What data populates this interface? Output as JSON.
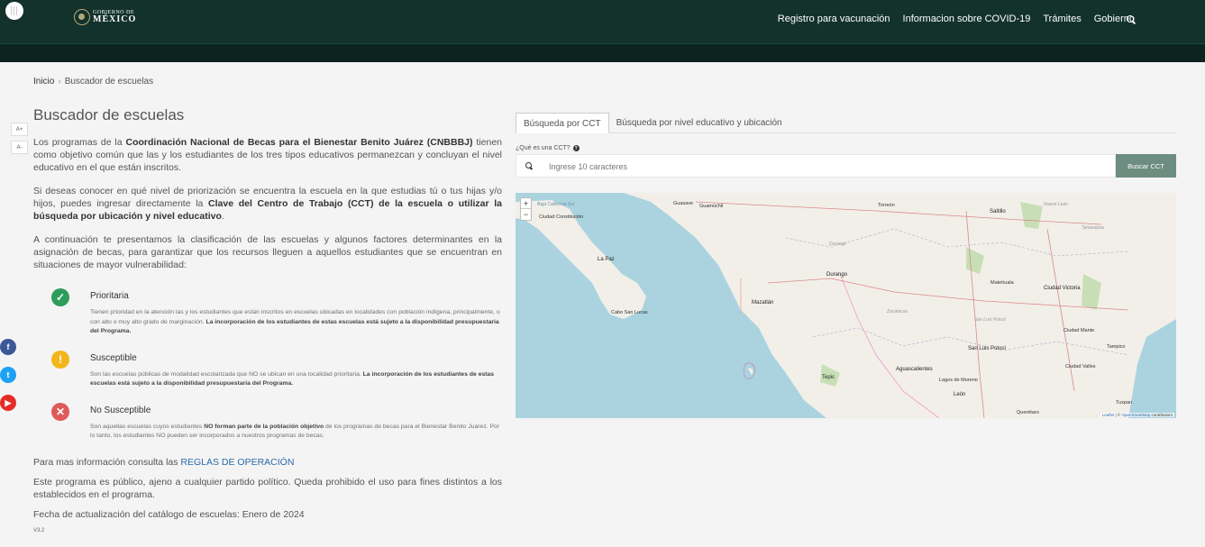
{
  "header": {
    "logo_line1": "GOBIERNO DE",
    "logo_line2": "MÉXICO",
    "nav": [
      "Registro para vacunación",
      "Informacion sobre COVID-19",
      "Trámites",
      "Gobierno"
    ]
  },
  "breadcrumb": {
    "home": "Inicio",
    "current": "Buscador de escuelas"
  },
  "font_tools": [
    "A+",
    "A-"
  ],
  "social": {
    "facebook": "f",
    "twitter": "t",
    "youtube": "▶"
  },
  "page": {
    "title": "Buscador de escuelas",
    "p1_a": "Los programas de la ",
    "p1_b": "Coordinación Nacional de Becas para el Bienestar Benito Juárez (CNBBBJ)",
    "p1_c": " tienen como objetivo común que las y los estudiantes de los tres tipos educativos permanezcan y concluyan el nivel educativo en el que están inscritos.",
    "p2_a": "Si deseas conocer en qué nivel de priorización se encuentra la escuela en la que estudias tú o tus hijas y/o hijos, puedes ingresar directamente la ",
    "p2_b": "Clave del Centro de Trabajo (CCT) de la escuela o utilizar la búsqueda por ubicación y nivel educativo",
    "p2_c": ".",
    "p3": "A continuación te presentamos la clasificación de las escuelas y algunos factores determinantes en la asignación de becas, para garantizar que los recursos lleguen a aquellos estudiantes que se encuentran en situaciones de mayor vulnerabilidad:"
  },
  "classes": [
    {
      "title": "Prioritaria",
      "icon": "check-icon",
      "color": "#2e9d5b",
      "desc_a": "Tienen prioridad en la atención las y los estudiantes que están inscritos en escuelas ubicadas en localidades con población indígena, principalmente, o con alto o muy alto grado de marginación. ",
      "desc_b": "La incorporación de los estudiantes de estas escuelas está sujeto a la disponibilidad presupuestaria del Programa."
    },
    {
      "title": "Susceptible",
      "icon": "exclamation-icon",
      "color": "#f2b61b",
      "desc_a": "Son las escuelas públicas de modalidad escolarizada que NO se ubican en una localidad prioritaria. ",
      "desc_b": "La incorporación de los estudiantes de estas escuelas está sujeto a la disponibilidad presupuestaria del Programa."
    },
    {
      "title": "No Susceptible",
      "icon": "x-icon",
      "color": "#e05a5a",
      "desc_a": "Son aquellas escuelas cuyos estudiantes ",
      "desc_b": "NO forman parte de la población objetivo",
      "desc_c": " de los programas de becas para el Bienestar Benito Juárez. Por lo tanto, los estudiantes NO pueden ser incorporados a nuestros programas de becas."
    }
  ],
  "footer": {
    "more_info": "Para mas información consulta las ",
    "rules_link": "REGLAS DE OPERACIÓN",
    "public_notice": "Este programa es público, ajeno a cualquier partido político. Queda prohibido el uso para fines distintos a los establecidos en el programa.",
    "update_date": "Fecha de actualización del catálogo de escuelas: Enero de 2024",
    "version": "V3.2"
  },
  "search": {
    "tab_cct": "Búsqueda por CCT",
    "tab_location": "Búsqueda por nivel educativo y ubicación",
    "cct_question": "¿Qué es una CCT?",
    "placeholder": "Ingrese 10 caracteres",
    "button": "Buscar CCT"
  },
  "map": {
    "zoom_in": "+",
    "zoom_out": "−",
    "attribution_a": "Leaflet",
    "attribution_b": " | © ",
    "attribution_c": "OpenStreetMap",
    "attribution_d": " contributors",
    "labels": {
      "baja_sur": "Baja California Sur",
      "ciudad_constitucion": "Ciudad Constitución",
      "la_paz": "La Paz",
      "cabo": "Cabo San Lucas",
      "guasave": "Guasave",
      "guamuchil": "Guamúchil",
      "torreon": "Torreón",
      "saltillo": "Saltillo",
      "nuevo_leon": "Nuevo León",
      "tamaulipas": "Tamaulipas",
      "durango_state": "Durango",
      "durango": "Durango",
      "mazatlan": "Mazatlán",
      "zacatecas": "Zacatecas",
      "ciudad_victoria": "Ciudad Victoria",
      "matehuala": "Matehuala",
      "slp_state": "San Luis Potosí",
      "slp": "San Luis Potosí",
      "ciudad_mante": "Ciudad Mante",
      "tampico": "Tampico",
      "aguascalientes": "Aguascalientes",
      "ciudad_valles": "Ciudad Valles",
      "tepic": "Tepic",
      "lagos": "Lagos de Moreno",
      "leon": "León",
      "tuxpan": "Tuxpan",
      "queretaro": "Querétaro"
    }
  }
}
